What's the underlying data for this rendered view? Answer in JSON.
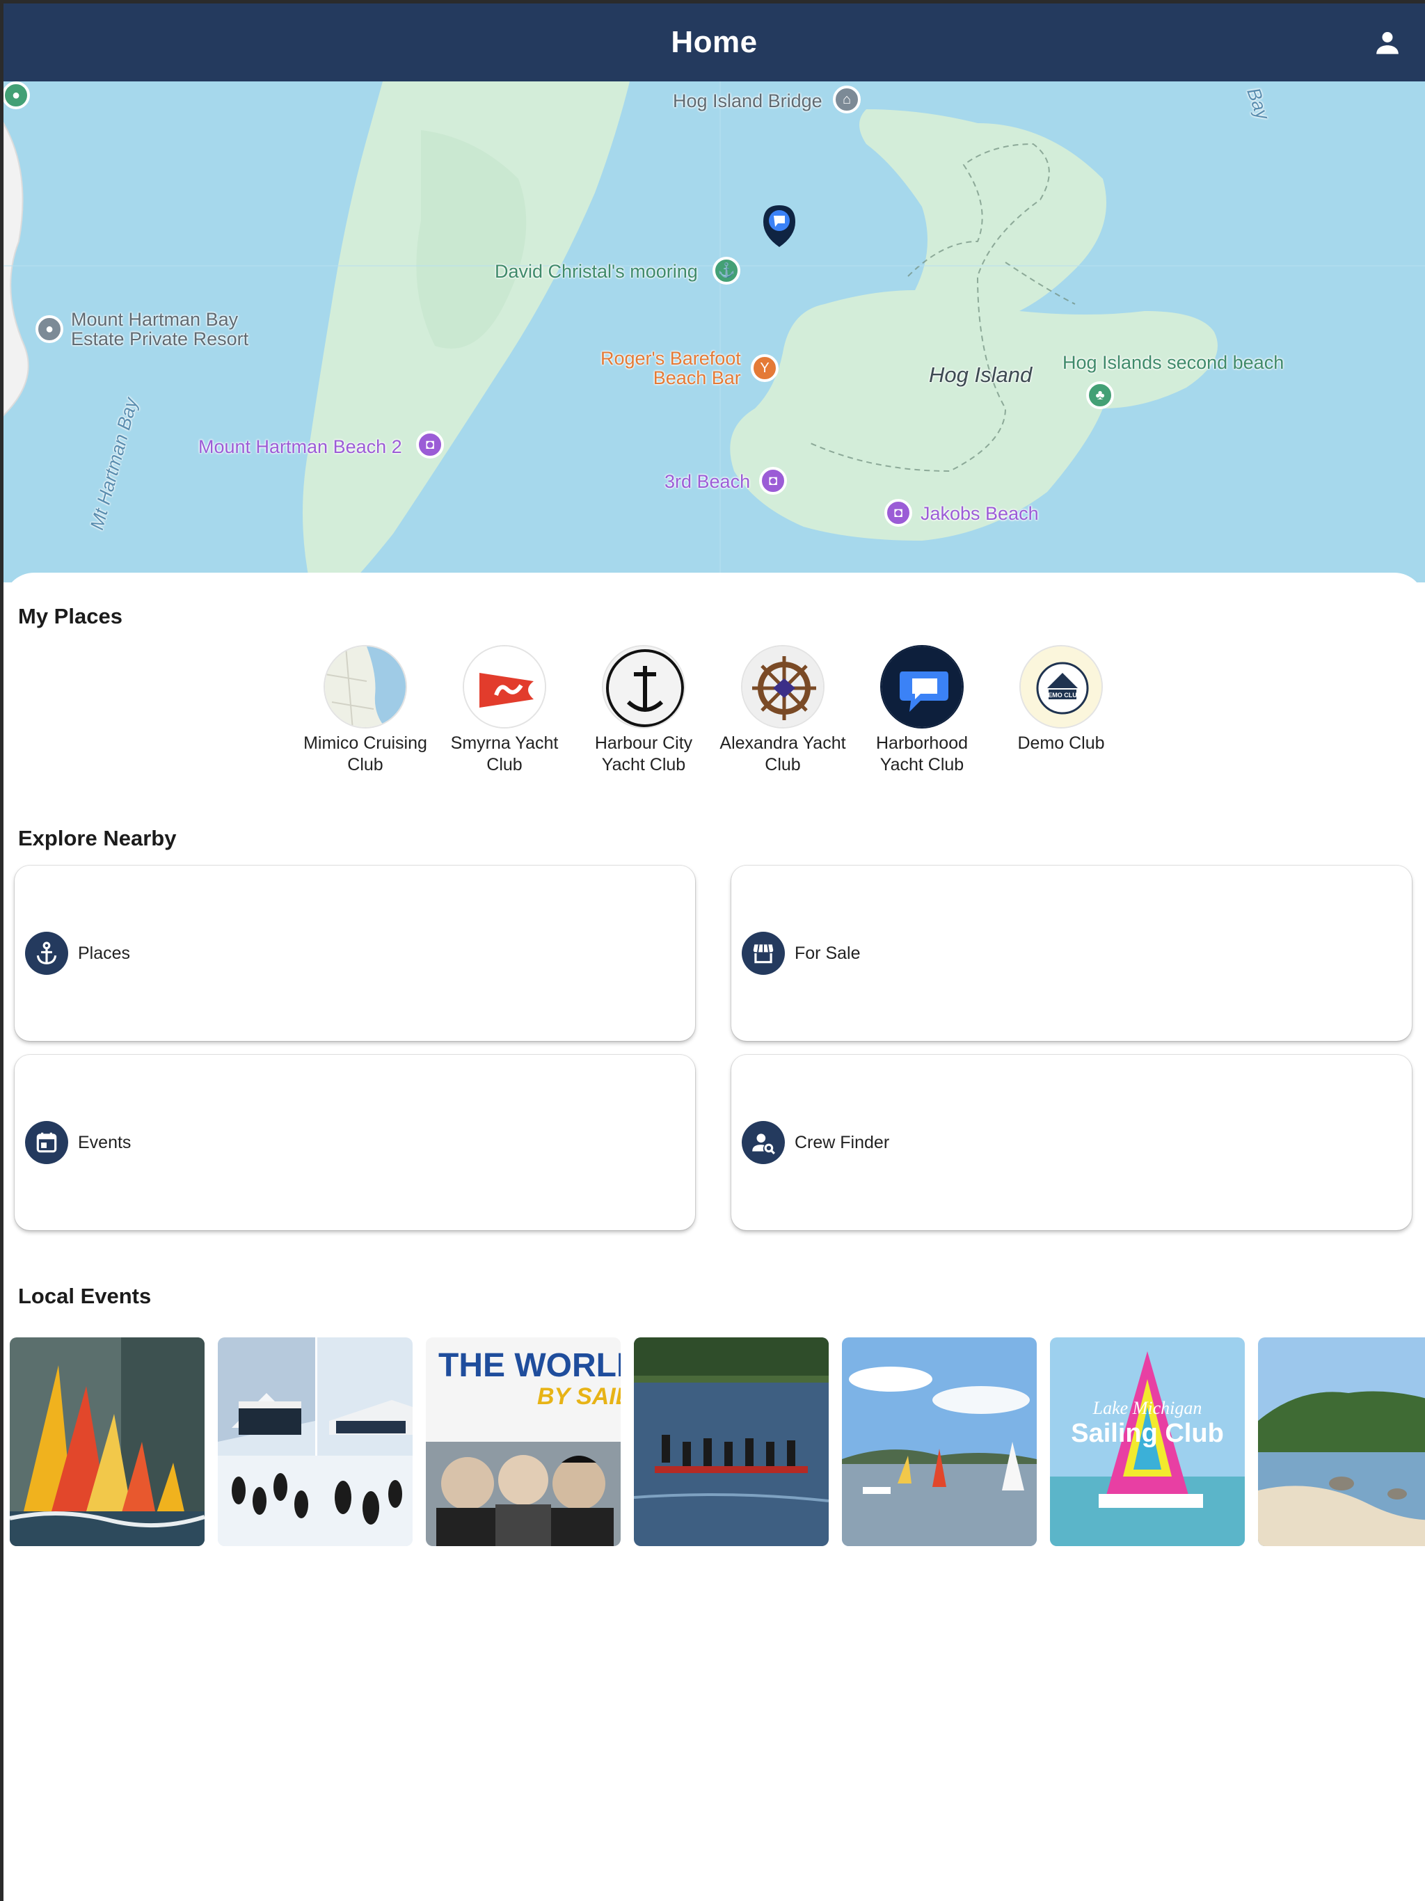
{
  "header": {
    "title": "Home"
  },
  "map": {
    "labels": {
      "bridge": "Hog Island Bridge",
      "mooring": "David Christal's mooring",
      "resort": "Mount Hartman Bay\nEstate Private Resort",
      "bar": "Roger's Barefoot\nBeach Bar",
      "island": "Hog Island",
      "second_beach": "Hog Islands second beach",
      "beach2": "Mount Hartman Beach 2",
      "third_beach": "3rd Beach",
      "jakobs": "Jakobs Beach",
      "bay": "Mt Hartman Bay",
      "bay_corner": "Bay"
    }
  },
  "my_places": {
    "title": "My Places",
    "items": [
      {
        "name": "Mimico Cruising Club"
      },
      {
        "name": "Smyrna Yacht Club"
      },
      {
        "name": "Harbour City Yacht Club"
      },
      {
        "name": "Alexandra Yacht Club"
      },
      {
        "name": "Harborhood Yacht Club"
      },
      {
        "name": "Demo Club",
        "logo_text": "DEMO CLUB"
      }
    ]
  },
  "explore": {
    "title": "Explore Nearby",
    "tiles": [
      {
        "label": "Places",
        "icon": "anchor-icon"
      },
      {
        "label": "For Sale",
        "icon": "storefront-icon"
      },
      {
        "label": "Events",
        "icon": "calendar-icon"
      },
      {
        "label": "Crew Finder",
        "icon": "person-search-icon"
      }
    ]
  },
  "local_events": {
    "title": "Local Events",
    "cards": [
      {
        "image": "abstract sailboats painting"
      },
      {
        "image": "cruise ships and penguins"
      },
      {
        "image": "The World by Sail poster",
        "headline": "THE WORLD",
        "subheadline": "BY SAIL"
      },
      {
        "image": "rowers on the water"
      },
      {
        "image": "small sailboats on lake"
      },
      {
        "image": "Lake Michigan Sailing Club",
        "headline": "Lake Michigan",
        "subheadline": "Sailing Club"
      },
      {
        "image": "sandy lake shore"
      }
    ]
  }
}
